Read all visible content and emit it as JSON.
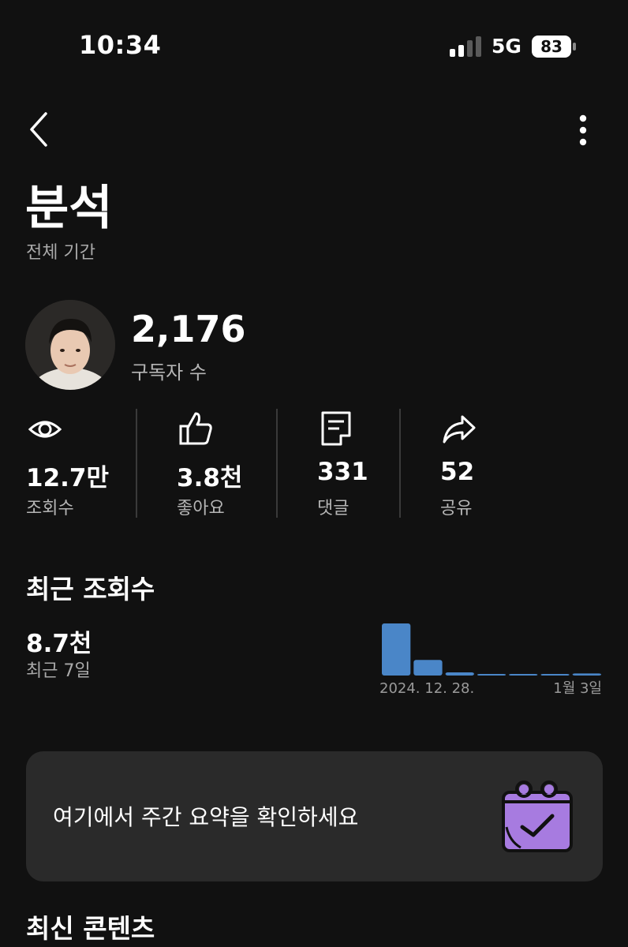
{
  "status_bar": {
    "time": "10:34",
    "network": "5G",
    "battery": "83"
  },
  "header": {
    "title": "분석",
    "period": "전체 기간"
  },
  "channel": {
    "subscribers": "2,176",
    "subscribers_label": "구독자 수"
  },
  "stats": [
    {
      "icon": "eye-icon",
      "value": "12.7만",
      "label": "조회수"
    },
    {
      "icon": "thumbs-up-icon",
      "value": "3.8천",
      "label": "좋아요"
    },
    {
      "icon": "comment-icon",
      "value": "331",
      "label": "댓글"
    },
    {
      "icon": "share-icon",
      "value": "52",
      "label": "공유"
    }
  ],
  "recent_views": {
    "title": "최근 조회수",
    "value": "8.7천",
    "period": "최근 7일"
  },
  "chart_data": {
    "type": "bar",
    "categories": [
      "2024. 12. 28.",
      "",
      "",
      "",
      "",
      "",
      "1월 3일"
    ],
    "values": [
      100,
      30,
      6,
      3,
      3,
      3,
      4
    ],
    "tick_labels": [
      "2024. 12. 28.",
      "1월 3일"
    ],
    "bar_color": "#4a86c8"
  },
  "weekly_summary": {
    "text": "여기에서 주간 요약을 확인하세요",
    "icon": "calendar-check-icon"
  },
  "latest_content": {
    "title": "최신 콘텐츠"
  },
  "colors": {
    "background": "#111111",
    "card": "#2a2a2a",
    "accent": "#4a86c8",
    "sticker": "#a77be0"
  }
}
